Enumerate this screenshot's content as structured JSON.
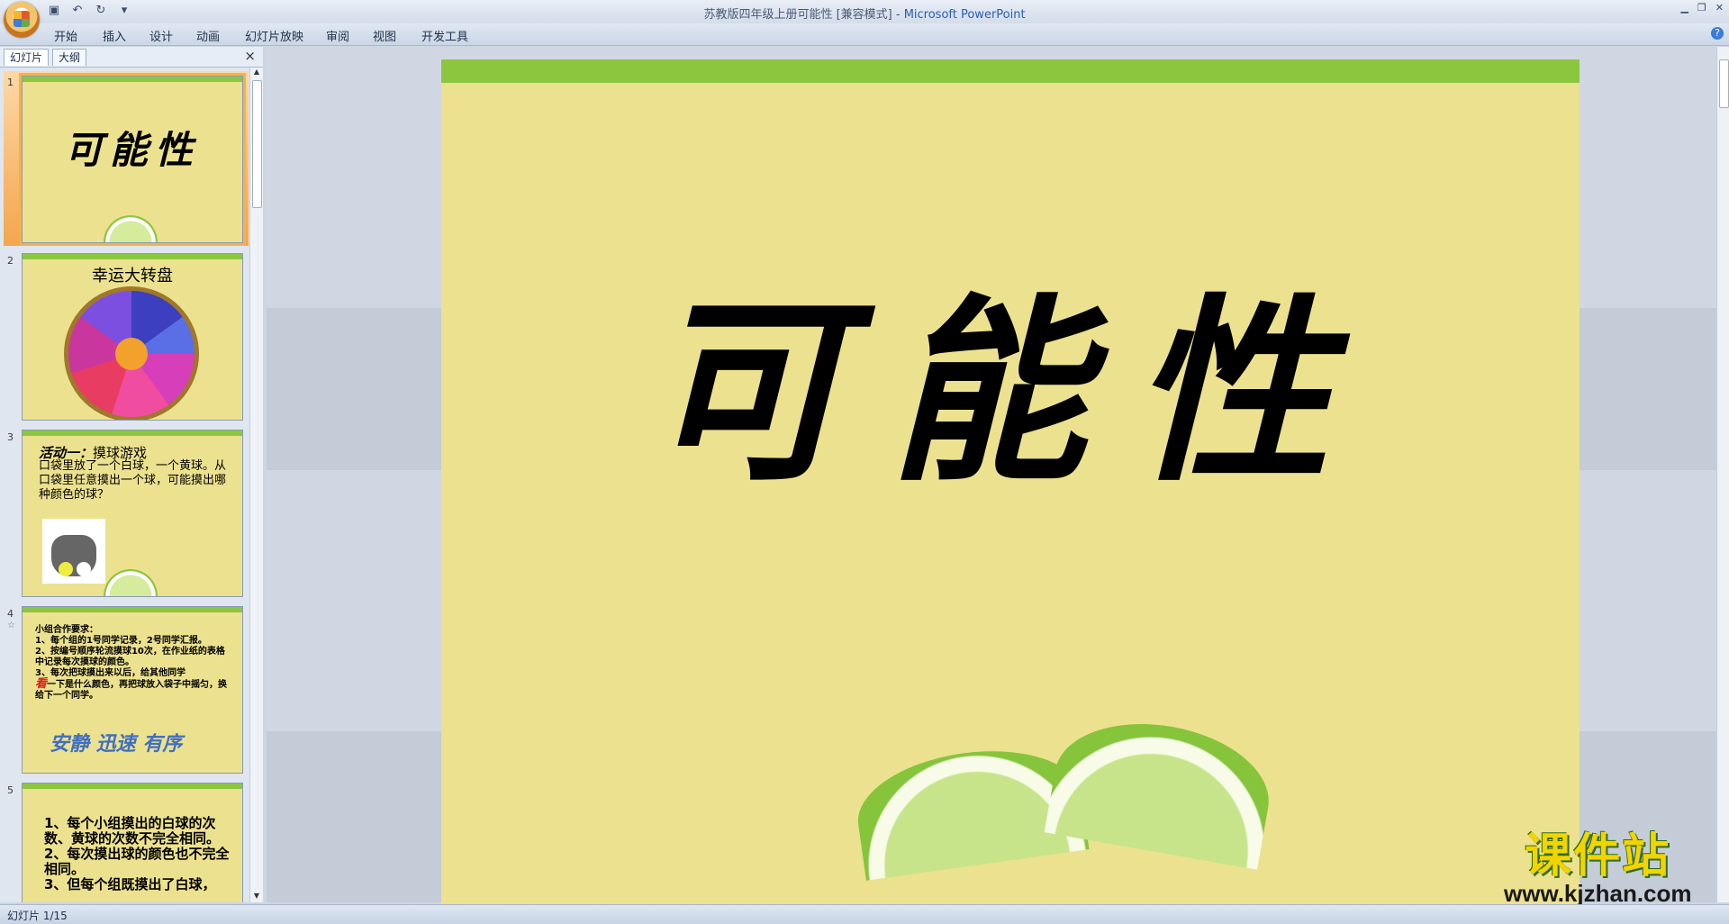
{
  "window": {
    "title": "苏教版四年级上册可能性 [兼容模式]",
    "app_name": "Microsoft PowerPoint",
    "qat_icons": [
      "save-icon",
      "undo-icon",
      "redo-icon",
      "customize-icon"
    ]
  },
  "ribbon": {
    "tabs": [
      "开始",
      "插入",
      "设计",
      "动画",
      "幻灯片放映",
      "审阅",
      "视图",
      "开发工具"
    ]
  },
  "panel": {
    "tabs": [
      "幻灯片",
      "大纲"
    ],
    "close_label": "×"
  },
  "slides": [
    {
      "num": "1",
      "title": "可能性"
    },
    {
      "num": "2",
      "title": "幸运大转盘"
    },
    {
      "num": "3",
      "title_bold": "活动一：",
      "title": "摸球游戏",
      "body": "口袋里放了一个白球，一个黄球。从口袋里任意摸出一个球，可能摸出哪种颜色的球？"
    },
    {
      "num": "4",
      "star": "☆",
      "lines": [
        "小组合作要求：",
        "1、每个组的1号同学记录，2号同学汇报。",
        "2、按编号顺序轮流摸球10次，在作业纸的表格中记录每次摸球的颜色。",
        "3、每次把球摸出来以后，给其他同学"
      ],
      "kan": "看",
      "line_end": "一下是什么颜色，再把球放入袋子中摇匀，换给下一个同学。",
      "footer": "安静  迅速  有序"
    },
    {
      "num": "5",
      "lines": [
        "1、每个小组摸出的白球的次数、黄球的次数不完全相同。",
        "2、每次摸出球的颜色也不完全相同。",
        "3、但每个组既摸出了白球，"
      ]
    }
  ],
  "main_slide": {
    "title": "可能性"
  },
  "watermark": {
    "text": "课件站",
    "url": "www.kjzhan.com"
  },
  "status": {
    "slide_info": "幻灯片 1/15"
  }
}
